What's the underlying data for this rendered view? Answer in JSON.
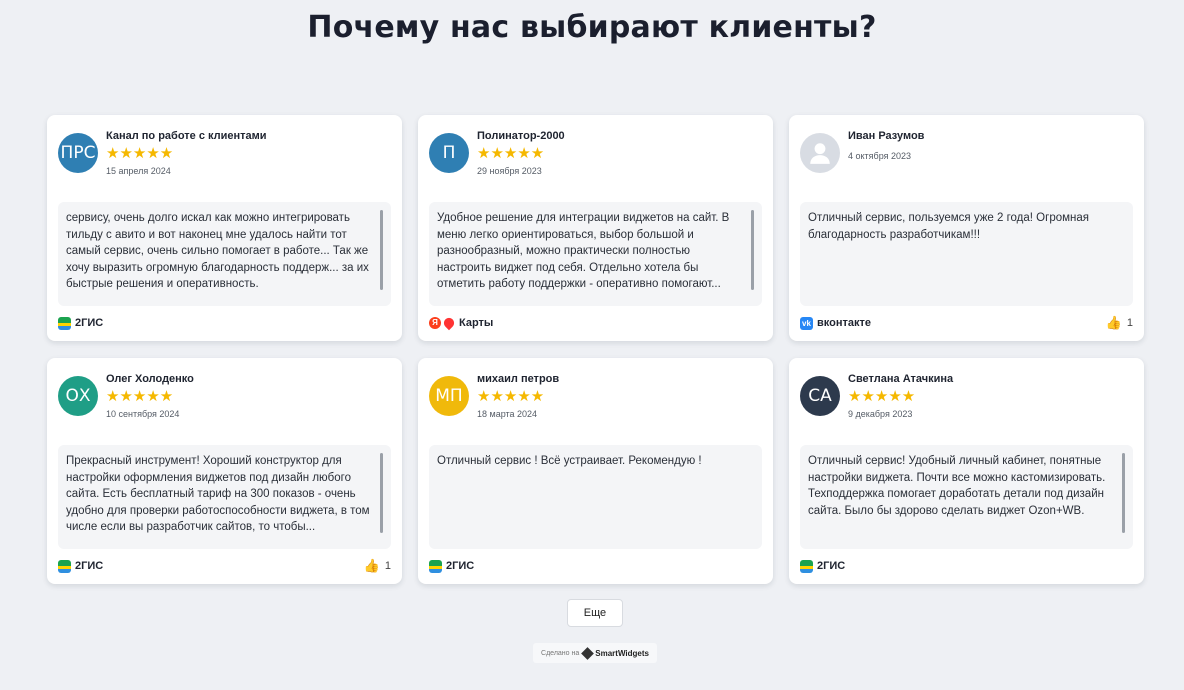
{
  "title": "Почему нас выбирают клиенты?",
  "stars": "★★★★★",
  "reviews": [
    {
      "initials": "ПРС",
      "avatar_color": "#2f7fb3",
      "name": "Канал по работе с клиентами",
      "date": "15 апреля 2024",
      "has_stars": true,
      "text": "сервису, очень долго искал как можно интегрировать тильду с авито и вот наконец мне удалось найти тот самый сервис, очень сильно помогает в работе... Так же хочу выразить огромную благодарность поддерж... за их быстрые решения и оперативность.",
      "source": "2ГИС",
      "source_icon": "2gis-icon",
      "likes": ""
    },
    {
      "initials": "П",
      "avatar_color": "#2f7fb3",
      "name": "Полинатор-2000",
      "date": "29 ноября 2023",
      "has_stars": true,
      "text": "Удобное решение для интеграции виджетов на сайт. В меню легко ориентироваться, выбор большой и разнообразный, можно практически полностью настроить виджет под себя. Отдельно хотела бы отметить работу поддержки - оперативно помогают...",
      "source": "Карты",
      "source_icon": "yandex-maps-icon",
      "likes": ""
    },
    {
      "initials": "",
      "avatar_color": "#d8dce3",
      "name": "Иван Разумов",
      "date": "4 октября 2023",
      "has_stars": false,
      "text": "Отличный сервис, пользуемся уже 2 года! Огромная благодарность разработчикам!!!",
      "source": "вконтакте",
      "source_icon": "vk-icon",
      "likes": "1"
    },
    {
      "initials": "ОХ",
      "avatar_color": "#1f9e86",
      "name": "Олег Холоденко",
      "date": "10 сентября 2024",
      "has_stars": true,
      "text": "Прекрасный инструмент! Хороший конструктор для настройки оформления виджетов под дизайн любого сайта. Есть бесплатный тариф на 300 показов - очень удобно для проверки работоспособности виджета, в том числе если вы разработчик сайтов, то чтобы...",
      "source": "2ГИС",
      "source_icon": "2gis-icon",
      "likes": "1"
    },
    {
      "initials": "МП",
      "avatar_color": "#f0b90b",
      "name": "михаил петров",
      "date": "18 марта 2024",
      "has_stars": true,
      "text": "Отличный сервис ! Всё устраивает. Рекомендую !",
      "source": "2ГИС",
      "source_icon": "2gis-icon",
      "likes": ""
    },
    {
      "initials": "СА",
      "avatar_color": "#2d3a4d",
      "name": "Светлана Атачкина",
      "date": "9 декабря 2023",
      "has_stars": true,
      "text": "Отличный сервис! Удобный личный кабинет, понятные настройки виджета. Почти все можно кастомизировать. Техподдержка помогает доработать детали под дизайн сайта. Было бы здорово сделать виджет Ozon+WB.",
      "source": "2ГИС",
      "source_icon": "2gis-icon",
      "likes": ""
    }
  ],
  "more_button": "Еще",
  "footer": {
    "made_with": "Сделано на",
    "brand": "SmartWidgets"
  }
}
